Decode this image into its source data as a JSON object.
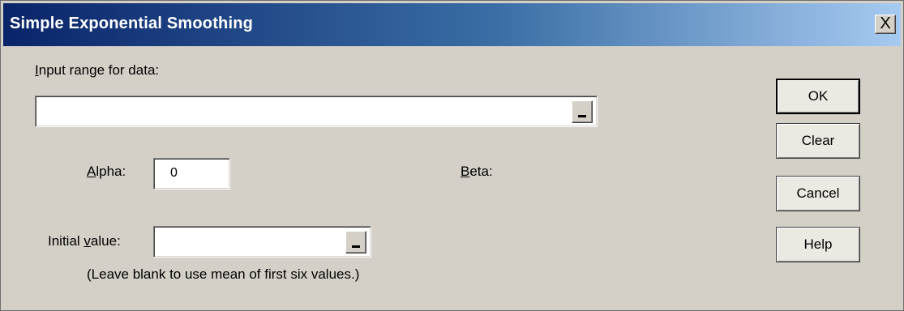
{
  "window": {
    "title": "Simple Exponential Smoothing",
    "close_label": "X"
  },
  "input_range": {
    "label_u": "I",
    "label_rest": "nput range for data:",
    "value": ""
  },
  "alpha": {
    "label_u": "A",
    "label_rest": "lpha:",
    "value": "0"
  },
  "beta": {
    "label_u": "B",
    "label_rest": "eta:"
  },
  "initial": {
    "label_pre": "Initial ",
    "label_u": "v",
    "label_rest": "alue:",
    "value": "",
    "hint": "(Leave blank to use mean of first six values.)"
  },
  "buttons": {
    "ok": "OK",
    "clear": "Clear",
    "cancel": "Cancel",
    "help": "Help"
  }
}
